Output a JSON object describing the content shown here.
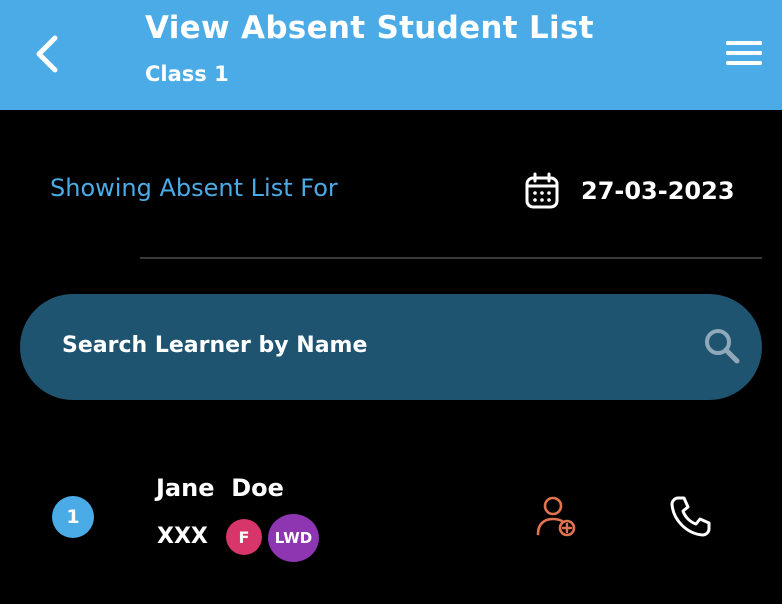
{
  "header": {
    "title": "View Absent Student List",
    "subtitle": "Class 1",
    "back_icon": "chevron-left-icon",
    "menu_icon": "hamburger-menu-icon",
    "background_color": "#4AABE6"
  },
  "filter": {
    "label": "Showing Absent List For",
    "date": "27-03-2023",
    "date_icon": "calendar-icon",
    "label_color": "#4AABE6"
  },
  "search": {
    "placeholder": "Search Learner by Name",
    "value": "",
    "icon": "search-icon",
    "background_color": "#1F5470"
  },
  "students": [
    {
      "index": "1",
      "name": "Jane  Doe",
      "code": "XXX",
      "badges": [
        {
          "label": "F",
          "color": "#D8356A"
        },
        {
          "label": "LWD",
          "color": "#8E35B1"
        }
      ],
      "actions": {
        "add_icon": "user-add-icon",
        "call_icon": "phone-icon"
      }
    }
  ]
}
